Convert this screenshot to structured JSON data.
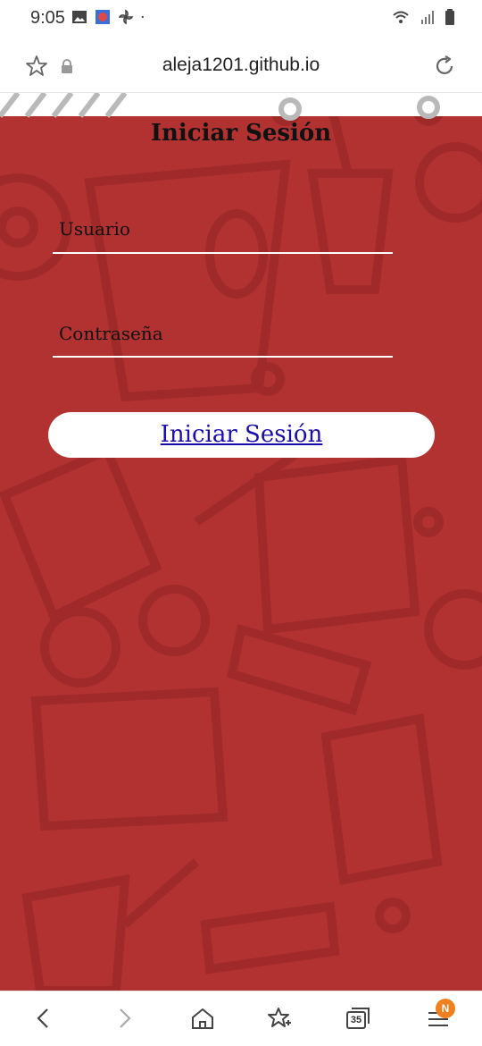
{
  "status_bar": {
    "time": "9:05",
    "left_icons": [
      "image-icon",
      "app-icon",
      "pinwheel-icon",
      "dot-icon"
    ],
    "right_icons": [
      "wifi-icon",
      "signal-icon",
      "battery-icon"
    ]
  },
  "browser": {
    "url": "aleja1201.github.io",
    "icons": [
      "star-icon",
      "lock-icon",
      "reload-icon"
    ]
  },
  "page": {
    "title": "Iniciar Sesión",
    "username_label": "Usuario",
    "password_label": "Contraseña",
    "username_value": "",
    "password_value": "",
    "login_button": "Iniciar Sesión",
    "background_color": "#b23232",
    "pattern_color": "#9f2a2a"
  },
  "bottom_nav": {
    "icons": [
      "back-icon",
      "forward-icon",
      "home-icon",
      "bookmark-add-icon",
      "tabs-icon",
      "menu-icon"
    ],
    "tabs_count": "35",
    "menu_badge": "N",
    "badge_color": "#f0801e"
  }
}
